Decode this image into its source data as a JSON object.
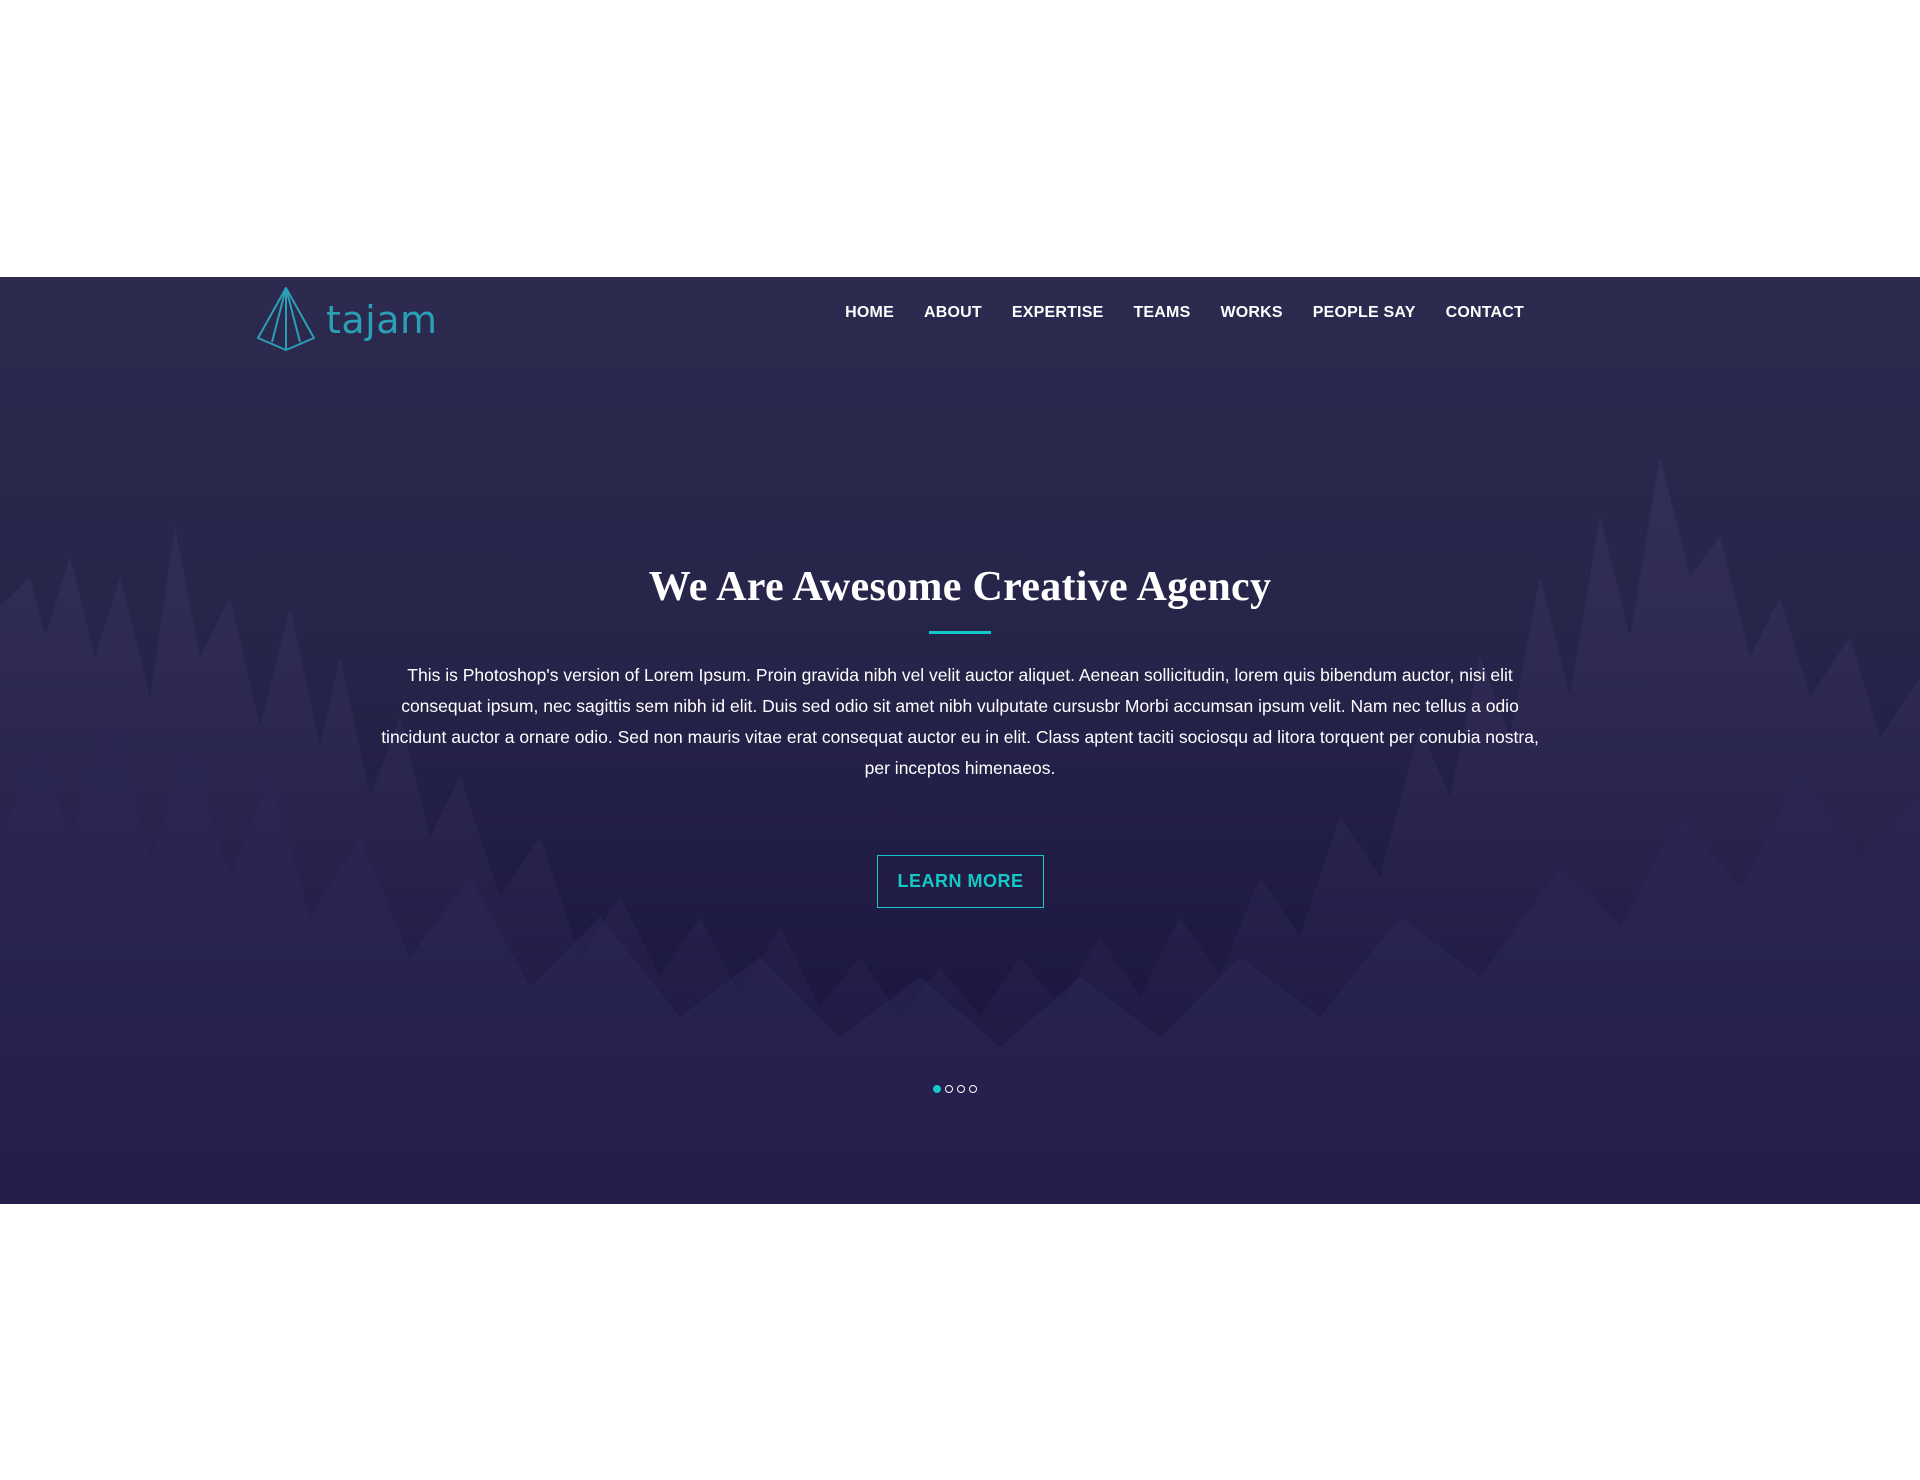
{
  "brand": {
    "name": "tajam",
    "accent_color": "#14c8c7",
    "logo_color": "#2a9fb5"
  },
  "nav": {
    "items": [
      {
        "label": "HOME"
      },
      {
        "label": "ABOUT"
      },
      {
        "label": "EXPERTISE"
      },
      {
        "label": "TEAMS"
      },
      {
        "label": "WORKS"
      },
      {
        "label": "PEOPLE SAY"
      },
      {
        "label": "CONTACT"
      }
    ]
  },
  "hero": {
    "title": "We Are Awesome Creative Agency",
    "description": "This is Photoshop's version of Lorem Ipsum. Proin gravida nibh vel velit auctor aliquet. Aenean sollicitudin, lorem quis bibendum auctor, nisi elit consequat ipsum, nec sagittis sem nibh id elit. Duis sed odio sit amet nibh vulputate cursusbr Morbi accumsan ipsum velit. Nam nec tellus a odio tincidunt auctor a ornare odio. Sed non mauris vitae erat consequat auctor eu in elit. Class aptent taciti sociosqu ad litora torquent per conubia nostra, per inceptos himenaeos.",
    "cta_label": "LEARN MORE",
    "background_colors": [
      "#2c2a4f",
      "#140f38"
    ]
  },
  "slider": {
    "total_slides": 4,
    "active_index": 0
  }
}
